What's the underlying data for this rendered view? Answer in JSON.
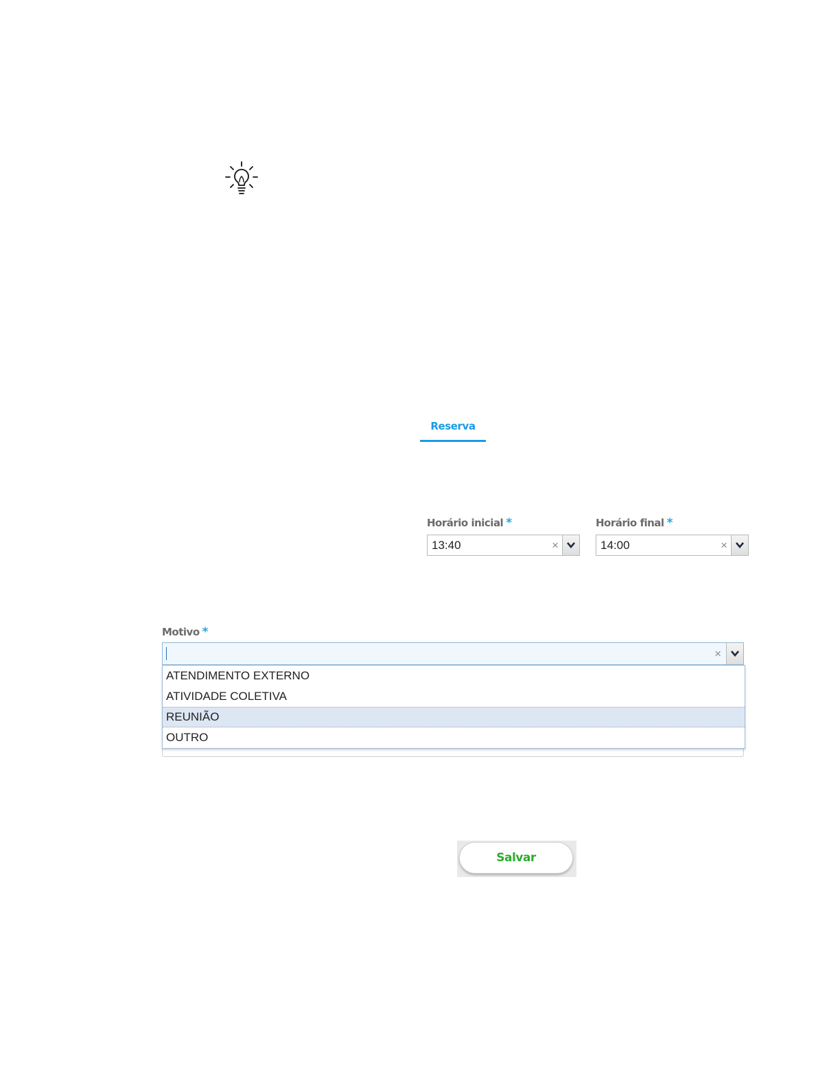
{
  "tip": {
    "icon": "lightbulb-icon"
  },
  "tabs": [
    {
      "label": "Reserva",
      "active": true
    }
  ],
  "form": {
    "required_marker": "*",
    "horario_inicial": {
      "label": "Horário inicial",
      "value": "13:40",
      "clear_symbol": "×"
    },
    "horario_final": {
      "label": "Horário final",
      "value": "14:00",
      "clear_symbol": "×"
    },
    "motivo": {
      "label": "Motivo",
      "value": "",
      "clear_symbol": "×",
      "dropdown_open": true,
      "options": [
        "ATENDIMENTO EXTERNO",
        "ATIVIDADE COLETIVA",
        "REUNIÃO",
        "OUTRO"
      ],
      "highlighted_option": "REUNIÃO"
    }
  },
  "actions": {
    "save_label": "Salvar"
  },
  "colors": {
    "accent_blue": "#1a9ae6",
    "required_blue": "#27a3e6",
    "save_green": "#2eab2e",
    "highlight_bg": "#dde6f3"
  }
}
